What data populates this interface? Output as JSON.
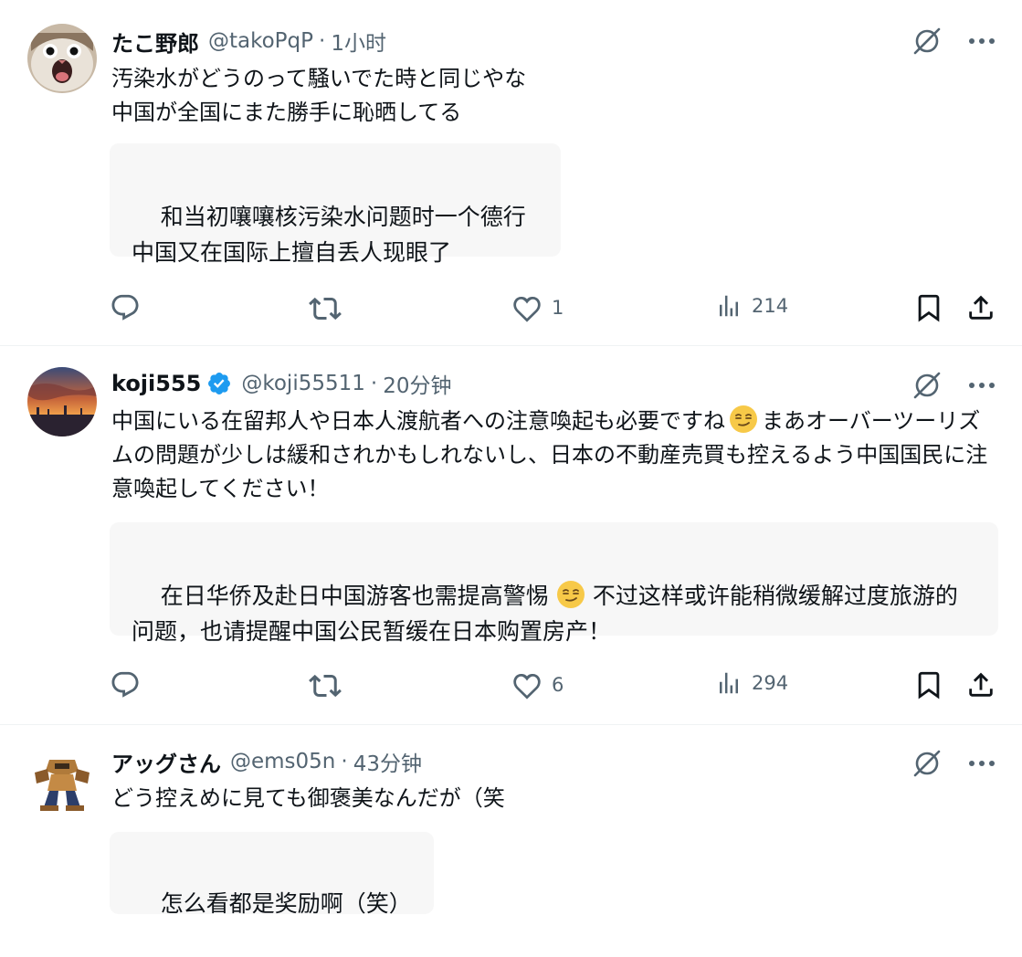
{
  "tweets": [
    {
      "name": "たこ野郎",
      "handle": "@takoPqP",
      "sep": "·",
      "time": "1小时",
      "verified": false,
      "body": "汚染水がどうのって騒いでた時と同じやな\n中国が全国にまた勝手に恥晒してる",
      "translation_a": "和当初嚷嚷核污染水问题时一个德行\n中国又在国际上擅自丢人现眼了",
      "translation_b": "",
      "reply_count": "",
      "repost_count": "",
      "like_count": "1",
      "view_count": "214",
      "avatar_icon": "cat-face-avatar"
    },
    {
      "name": "koji555",
      "handle": "@koji55511",
      "sep": "·",
      "time": "20分钟",
      "verified": true,
      "body_a": "中国にいる在留邦人や日本人渡航者への注意喚起も必要ですね",
      "body_b": "まあオーバーツーリズムの問題が少しは緩和されかもしれないし、日本の不動産売買も控えるよう中国国民に注意喚起してください！",
      "translation_a": "在日华侨及赴日中国游客也需提高警惕",
      "translation_b": "不过这样或许能稍微缓解过度旅游的问题，也请提醒中国公民暂缓在日本购置房产！",
      "reply_count": "",
      "repost_count": "",
      "like_count": "6",
      "view_count": "294",
      "avatar_icon": "sunset-avatar"
    },
    {
      "name": "アッグさん",
      "handle": "@ems05n",
      "sep": "·",
      "time": "43分钟",
      "verified": false,
      "body": "どう控えめに見ても御褒美なんだが（笑",
      "translation_a": "怎么看都是奖励啊（笑）",
      "avatar_icon": "robot-avatar"
    }
  ],
  "colors": {
    "text": "#0f1419",
    "secondary": "#536471",
    "verified": "#1d9bf0",
    "translation_bg": "#f7f7f7",
    "divider": "#eff3f4"
  },
  "icons": {
    "grok": "grok-icon",
    "more": "more-icon",
    "reply": "reply-icon",
    "repost": "repost-icon",
    "like": "like-icon",
    "views": "views-icon",
    "bookmark": "bookmark-icon",
    "share": "share-icon",
    "emoji": "smirk-emoji-icon"
  }
}
